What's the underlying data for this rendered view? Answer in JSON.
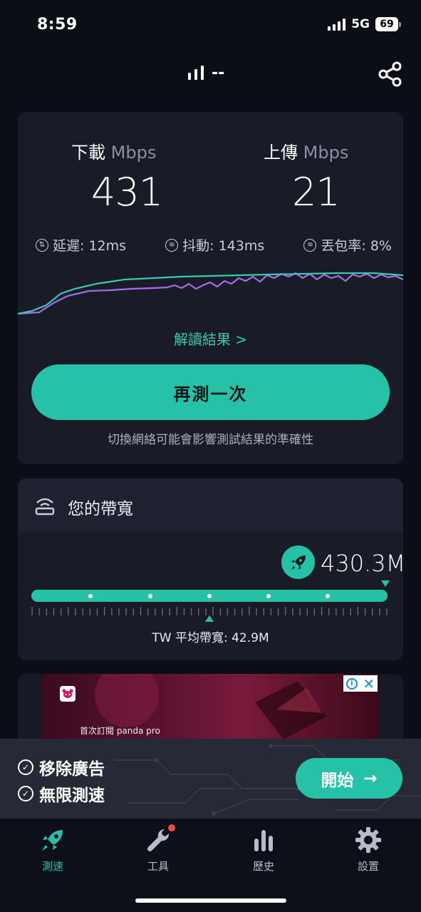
{
  "status_bar": {
    "time": "8:59",
    "network": "5G",
    "battery": "69"
  },
  "header": {
    "connection": "--"
  },
  "result": {
    "download_label": "下載",
    "upload_label": "上傳",
    "unit": "Mbps",
    "download_value": "431",
    "upload_value": "21",
    "latency": "延遲: 12ms",
    "jitter": "抖動: 143ms",
    "packet_loss": "丟包率: 8%",
    "interpret_link": "解讀結果 >",
    "retest_button": "再測一次",
    "hint": "切換網絡可能會影響測試結果的準確性"
  },
  "bandwidth": {
    "title": "您的帶寬",
    "value": "430.3M",
    "avg_label": "TW 平均帶寬: 42.9M",
    "user_fraction": 1.0,
    "avg_fraction": 0.5
  },
  "ad": {
    "text": "首次訂閱 panda pro"
  },
  "promo": {
    "item1": "移除廣告",
    "item2": "無限測速",
    "start_button": "開始"
  },
  "tabs": [
    {
      "label": "測速",
      "icon": "rocket-icon",
      "active": true
    },
    {
      "label": "工具",
      "icon": "wrench-icon",
      "active": false
    },
    {
      "label": "歷史",
      "icon": "bar-chart-icon",
      "active": false
    },
    {
      "label": "設置",
      "icon": "gear-icon",
      "active": false
    }
  ],
  "colors": {
    "accent": "#25c2a8",
    "background": "#0b0d17",
    "card": "#191c27",
    "download_line": "#3bc8b0",
    "upload_line": "#a86ce8"
  }
}
